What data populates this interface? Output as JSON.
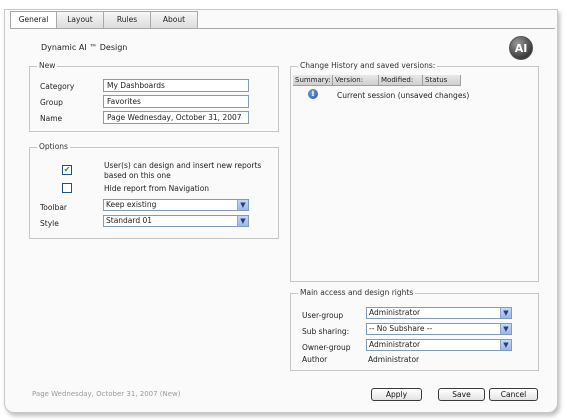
{
  "tabs": [
    "General",
    "Layout",
    "Rules",
    "About"
  ],
  "title": "Dynamic AI ™ Design",
  "logo_text": "AI",
  "new_group": {
    "legend": "New",
    "category_label": "Category",
    "category_value": "My Dashboards",
    "group_label": "Group",
    "group_value": "Favorites",
    "name_label": "Name",
    "name_value": "Page Wednesday, October 31, 2007"
  },
  "options_group": {
    "legend": "Options",
    "checkbox1_label_line1": "User(s) can design and insert new reports",
    "checkbox1_label_line2": "based on this one",
    "checkbox1_checked": true,
    "checkbox2_label": "Hide report from Navigation",
    "checkbox2_checked": false,
    "toolbar_label": "Toolbar",
    "toolbar_value": "Keep existing",
    "style_label": "Style",
    "style_value": "Standard 01"
  },
  "history": {
    "legend": "Change History and saved versions:",
    "columns": [
      "Summary:",
      "Version:",
      "Modified:",
      "Status"
    ],
    "row_text": "Current session (unsaved changes)",
    "info_icon": "info-icon"
  },
  "access": {
    "legend": "Main access and design rights",
    "usergroup_label": "User-group",
    "usergroup_value": "Administrator",
    "subsharing_label": "Sub sharing:",
    "subsharing_value": "-- No Subshare --",
    "ownergroup_label": "Owner-group",
    "ownergroup_value": "Administrator",
    "author_label": "Author",
    "author_value": "Administrator"
  },
  "footer": "Page Wednesday, October 31, 2007 (New)",
  "buttons": {
    "apply": "Apply",
    "save": "Save",
    "cancel": "Cancel"
  }
}
